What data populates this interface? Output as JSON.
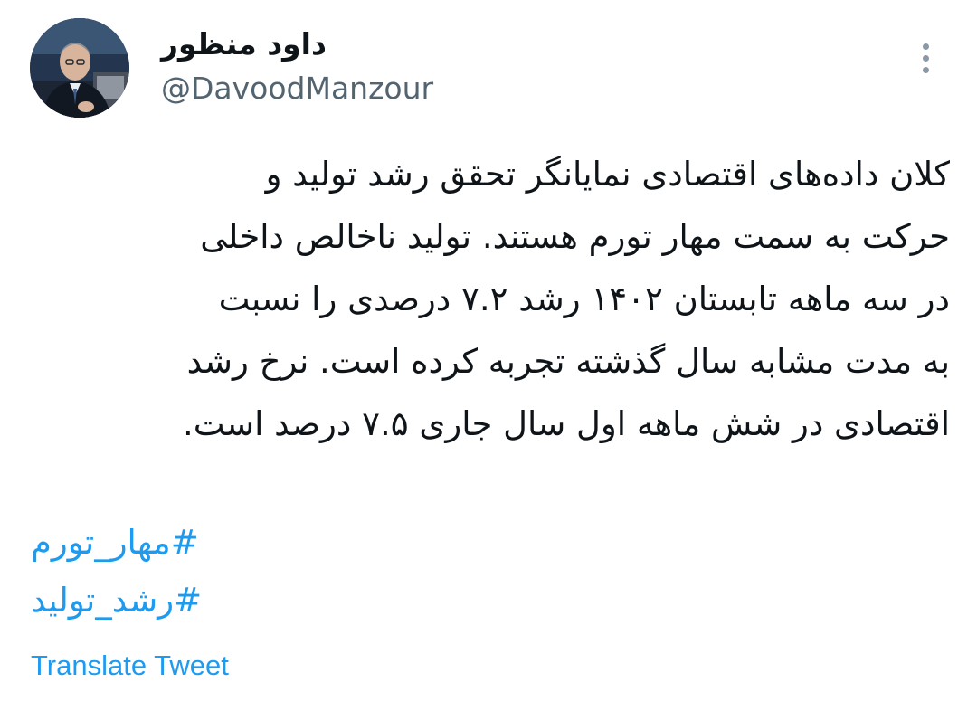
{
  "author": {
    "display_name": "داود منظور",
    "handle": "@DavoodManzour",
    "avatar_icon": "profile-photo"
  },
  "more_icon": "more-vertical-icon",
  "tweet": {
    "lines": [
      "کلان داده‌های اقتصادی نمایانگر تحقق رشد تولید و",
      "حرکت به سمت مهار تورم هستند. تولید ناخالص داخلی",
      "در سه ماهه تابستان ۱۴۰۲ رشد ۷.۲ درصدی را نسبت",
      "به مدت مشابه سال گذشته تجربه کرده است. نرخ رشد",
      "اقتصادی در شش ماهه اول سال جاری ۷.۵ درصد است."
    ],
    "hashtags": [
      "#مهار_تورم",
      "#رشد_تولید"
    ],
    "translate_label": "Translate Tweet"
  },
  "colors": {
    "text": "#0f1419",
    "secondary": "#536471",
    "link": "#1d9bf0",
    "background": "#ffffff"
  }
}
